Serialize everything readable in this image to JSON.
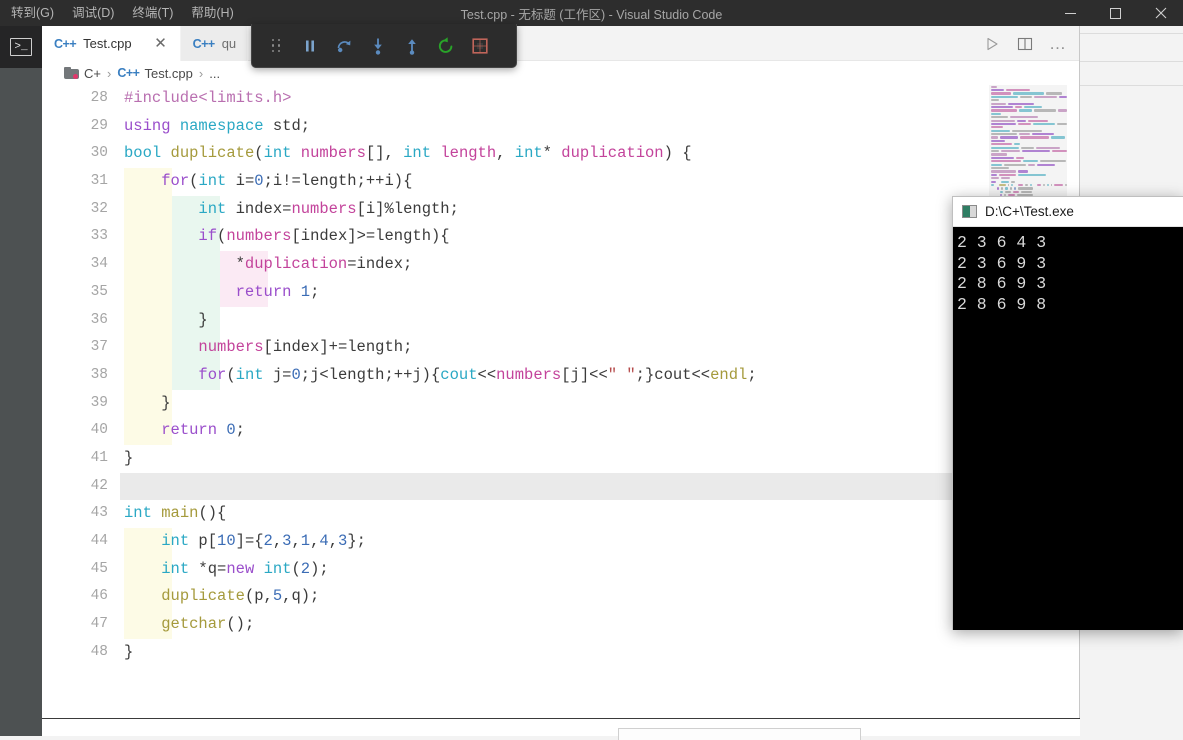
{
  "window": {
    "title": "Test.cpp - 无标题 (工作区) - Visual Studio Code",
    "minimize": "—",
    "maximize": "❐",
    "close": "✕"
  },
  "menubar": {
    "items": [
      {
        "label": "转到(G)",
        "name": "menu-goto"
      },
      {
        "label": "调试(D)",
        "name": "menu-debug"
      },
      {
        "label": "终端(T)",
        "name": "menu-terminal"
      },
      {
        "label": "帮助(H)",
        "name": "menu-help"
      }
    ]
  },
  "activitybar": {
    "terminal_glyph": ">_"
  },
  "tabs": [
    {
      "label": "Test.cpp",
      "icon": "C++",
      "close": "✕",
      "active": true
    },
    {
      "label": "qu",
      "icon": "C++",
      "close": "",
      "active": false
    }
  ],
  "editor_actions": {
    "run": "run-icon",
    "split": "split-editor-icon",
    "more": "…"
  },
  "breadcrumbs": {
    "items": [
      "C+",
      "Test.cpp",
      "..."
    ],
    "separator": "›"
  },
  "debug_toolbar": {
    "buttons": [
      {
        "name": "drag-handle",
        "title": "拖动"
      },
      {
        "name": "pause-button",
        "title": "暂停"
      },
      {
        "name": "step-over-button",
        "title": "单步跳过"
      },
      {
        "name": "step-into-button",
        "title": "单步调试"
      },
      {
        "name": "step-out-button",
        "title": "单步跳出"
      },
      {
        "name": "restart-button",
        "title": "重启"
      },
      {
        "name": "stop-button",
        "title": "停止"
      }
    ]
  },
  "console": {
    "title": "D:\\C+\\Test.exe",
    "output": "2 3 6 4 3\n2 3 6 9 3\n2 8 6 9 3\n2 8 6 9 8"
  },
  "code": {
    "current_line": 42,
    "lines": [
      {
        "n": "28",
        "segments": [
          {
            "t": "#include",
            "c": "t-pp"
          },
          {
            "t": "<limits.h>",
            "c": "t-pp"
          }
        ],
        "guides": []
      },
      {
        "n": "29",
        "segments": [
          {
            "t": "using",
            "c": "t-key"
          },
          {
            "t": " ",
            "c": "t-plain"
          },
          {
            "t": "namespace",
            "c": "t-ns"
          },
          {
            "t": " std;",
            "c": "t-plain"
          }
        ],
        "guides": []
      },
      {
        "n": "30",
        "segments": [
          {
            "t": "bool",
            "c": "t-type"
          },
          {
            "t": " ",
            "c": "t-plain"
          },
          {
            "t": "duplicate",
            "c": "t-fn"
          },
          {
            "t": "(",
            "c": "t-punct"
          },
          {
            "t": "int",
            "c": "t-type"
          },
          {
            "t": " ",
            "c": "t-plain"
          },
          {
            "t": "numbers",
            "c": "t-var"
          },
          {
            "t": "[], ",
            "c": "t-punct"
          },
          {
            "t": "int",
            "c": "t-type"
          },
          {
            "t": " ",
            "c": "t-plain"
          },
          {
            "t": "length",
            "c": "t-var"
          },
          {
            "t": ", ",
            "c": "t-punct"
          },
          {
            "t": "int",
            "c": "t-type"
          },
          {
            "t": "* ",
            "c": "t-punct"
          },
          {
            "t": "duplication",
            "c": "t-var"
          },
          {
            "t": ") {",
            "c": "t-punct"
          }
        ],
        "guides": []
      },
      {
        "n": "31",
        "segments": [
          {
            "t": "    ",
            "c": "t-plain"
          },
          {
            "t": "for",
            "c": "t-key"
          },
          {
            "t": "(",
            "c": "t-punct"
          },
          {
            "t": "int",
            "c": "t-type"
          },
          {
            "t": " i=",
            "c": "t-plain"
          },
          {
            "t": "0",
            "c": "t-num"
          },
          {
            "t": ";i!=length;++i){",
            "c": "t-plain"
          }
        ],
        "guides": [
          "yellow"
        ]
      },
      {
        "n": "32",
        "segments": [
          {
            "t": "        ",
            "c": "t-plain"
          },
          {
            "t": "int",
            "c": "t-type"
          },
          {
            "t": " index=",
            "c": "t-plain"
          },
          {
            "t": "numbers",
            "c": "t-var"
          },
          {
            "t": "[i]%length;",
            "c": "t-plain"
          }
        ],
        "guides": [
          "yellow",
          "green"
        ]
      },
      {
        "n": "33",
        "segments": [
          {
            "t": "        ",
            "c": "t-plain"
          },
          {
            "t": "if",
            "c": "t-key"
          },
          {
            "t": "(",
            "c": "t-punct"
          },
          {
            "t": "numbers",
            "c": "t-var"
          },
          {
            "t": "[index]>=length){",
            "c": "t-plain"
          }
        ],
        "guides": [
          "yellow",
          "green"
        ]
      },
      {
        "n": "34",
        "segments": [
          {
            "t": "            *",
            "c": "t-plain"
          },
          {
            "t": "duplication",
            "c": "t-var"
          },
          {
            "t": "=index;",
            "c": "t-plain"
          }
        ],
        "guides": [
          "yellow",
          "green",
          "pink"
        ]
      },
      {
        "n": "35",
        "segments": [
          {
            "t": "            ",
            "c": "t-plain"
          },
          {
            "t": "return",
            "c": "t-key"
          },
          {
            "t": " ",
            "c": "t-plain"
          },
          {
            "t": "1",
            "c": "t-num"
          },
          {
            "t": ";",
            "c": "t-plain"
          }
        ],
        "guides": [
          "yellow",
          "green",
          "pink"
        ]
      },
      {
        "n": "36",
        "segments": [
          {
            "t": "        }",
            "c": "t-plain"
          }
        ],
        "guides": [
          "yellow",
          "green"
        ]
      },
      {
        "n": "37",
        "segments": [
          {
            "t": "        ",
            "c": "t-plain"
          },
          {
            "t": "numbers",
            "c": "t-var"
          },
          {
            "t": "[index]+=length;",
            "c": "t-plain"
          }
        ],
        "guides": [
          "yellow",
          "green"
        ]
      },
      {
        "n": "38",
        "segments": [
          {
            "t": "        ",
            "c": "t-plain"
          },
          {
            "t": "for",
            "c": "t-key"
          },
          {
            "t": "(",
            "c": "t-punct"
          },
          {
            "t": "int",
            "c": "t-type"
          },
          {
            "t": " j=",
            "c": "t-plain"
          },
          {
            "t": "0",
            "c": "t-num"
          },
          {
            "t": ";j<length;++j){",
            "c": "t-plain"
          },
          {
            "t": "cout",
            "c": "t-b2"
          },
          {
            "t": "<<",
            "c": "t-plain"
          },
          {
            "t": "numbers",
            "c": "t-var"
          },
          {
            "t": "[j]<<",
            "c": "t-plain"
          },
          {
            "t": "\" \"",
            "c": "t-str"
          },
          {
            "t": ";}",
            "c": "t-plain"
          },
          {
            "t": "cout",
            "c": "t-plain"
          },
          {
            "t": "<<",
            "c": "t-plain"
          },
          {
            "t": "endl",
            "c": "t-fn"
          },
          {
            "t": ";",
            "c": "t-plain"
          }
        ],
        "guides": [
          "yellow",
          "green"
        ]
      },
      {
        "n": "39",
        "segments": [
          {
            "t": "    }",
            "c": "t-plain"
          }
        ],
        "guides": [
          "yellow"
        ]
      },
      {
        "n": "40",
        "segments": [
          {
            "t": "    ",
            "c": "t-plain"
          },
          {
            "t": "return",
            "c": "t-key"
          },
          {
            "t": " ",
            "c": "t-plain"
          },
          {
            "t": "0",
            "c": "t-num"
          },
          {
            "t": ";",
            "c": "t-plain"
          }
        ],
        "guides": [
          "yellow"
        ]
      },
      {
        "n": "41",
        "segments": [
          {
            "t": "}",
            "c": "t-plain"
          }
        ],
        "guides": []
      },
      {
        "n": "42",
        "segments": [
          {
            "t": "",
            "c": "t-plain"
          }
        ],
        "guides": []
      },
      {
        "n": "43",
        "segments": [
          {
            "t": "int",
            "c": "t-type"
          },
          {
            "t": " ",
            "c": "t-plain"
          },
          {
            "t": "main",
            "c": "t-fn"
          },
          {
            "t": "(){",
            "c": "t-punct"
          }
        ],
        "guides": []
      },
      {
        "n": "44",
        "segments": [
          {
            "t": "    ",
            "c": "t-plain"
          },
          {
            "t": "int",
            "c": "t-type"
          },
          {
            "t": " p[",
            "c": "t-plain"
          },
          {
            "t": "10",
            "c": "t-num"
          },
          {
            "t": "]={",
            "c": "t-plain"
          },
          {
            "t": "2",
            "c": "t-num"
          },
          {
            "t": ",",
            "c": "t-plain"
          },
          {
            "t": "3",
            "c": "t-num"
          },
          {
            "t": ",",
            "c": "t-plain"
          },
          {
            "t": "1",
            "c": "t-num"
          },
          {
            "t": ",",
            "c": "t-plain"
          },
          {
            "t": "4",
            "c": "t-num"
          },
          {
            "t": ",",
            "c": "t-plain"
          },
          {
            "t": "3",
            "c": "t-num"
          },
          {
            "t": "};",
            "c": "t-plain"
          }
        ],
        "guides": [
          "yellow"
        ]
      },
      {
        "n": "45",
        "segments": [
          {
            "t": "    ",
            "c": "t-plain"
          },
          {
            "t": "int",
            "c": "t-type"
          },
          {
            "t": " *q=",
            "c": "t-plain"
          },
          {
            "t": "new",
            "c": "t-key"
          },
          {
            "t": " ",
            "c": "t-plain"
          },
          {
            "t": "int",
            "c": "t-type"
          },
          {
            "t": "(",
            "c": "t-punct"
          },
          {
            "t": "2",
            "c": "t-num"
          },
          {
            "t": ");",
            "c": "t-punct"
          }
        ],
        "guides": [
          "yellow"
        ]
      },
      {
        "n": "46",
        "segments": [
          {
            "t": "    ",
            "c": "t-plain"
          },
          {
            "t": "duplicate",
            "c": "t-fn"
          },
          {
            "t": "(p,",
            "c": "t-plain"
          },
          {
            "t": "5",
            "c": "t-num"
          },
          {
            "t": ",q);",
            "c": "t-plain"
          }
        ],
        "guides": [
          "yellow"
        ]
      },
      {
        "n": "47",
        "segments": [
          {
            "t": "    ",
            "c": "t-plain"
          },
          {
            "t": "getchar",
            "c": "t-fn"
          },
          {
            "t": "();",
            "c": "t-punct"
          }
        ],
        "guides": [
          "yellow"
        ]
      },
      {
        "n": "48",
        "segments": [
          {
            "t": "}",
            "c": "t-plain"
          }
        ],
        "guides": []
      }
    ]
  },
  "colors": {
    "titlebar_bg": "#2d2d2d",
    "activitybar_bg": "#4d5152",
    "editor_bg": "#ffffff",
    "console_bg": "#000000",
    "accent_stop": "#c0392b",
    "accent_restart": "#29a329",
    "accent_step": "#5b8bbf"
  }
}
